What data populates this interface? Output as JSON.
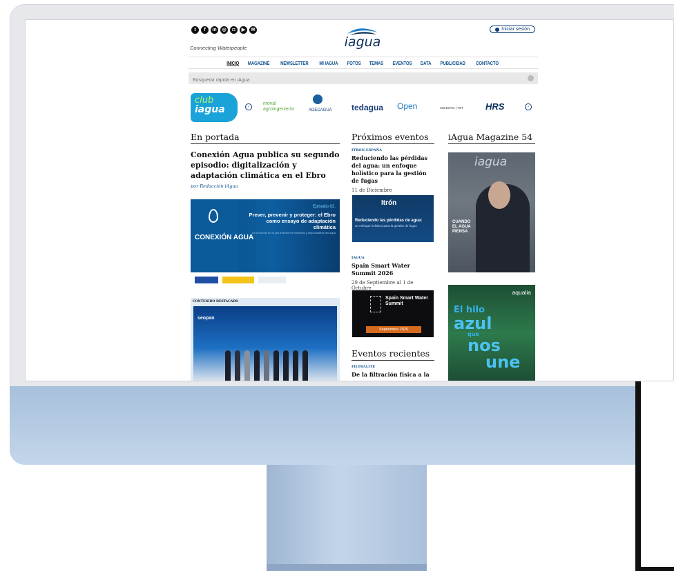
{
  "site": {
    "socials": [
      "Twitter",
      "Facebook",
      "LinkedIn",
      "Instagram",
      "Flickr",
      "YouTube",
      "Email"
    ],
    "social_glyphs": [
      "t",
      "f",
      "in",
      "◎",
      "◘",
      "▶",
      "✉"
    ],
    "tagline": "Connecting Waterpeople",
    "logo_text": "iagua",
    "login_label": "Iniciar sesión",
    "nav": [
      "INICIO",
      "MAGAZINE",
      "NEWSLETTER",
      "MI IAGUA",
      "FOTOS",
      "TEMAS",
      "EVENTOS",
      "DATA",
      "PUBLICIDAD",
      "CONTACTO"
    ],
    "search_placeholder": "Búsqueda rápida en iAgua",
    "club_line1": "club",
    "club_line2": "iagua",
    "sponsors": [
      "moval agroingeniería",
      "ADECAGUA",
      "tedagua",
      "Open",
      "CELESTIA | TST",
      "HRS"
    ],
    "prev_arrow": "‹",
    "next_arrow": "›",
    "accent": "#0b4e8c"
  },
  "portada": {
    "title": "En portada",
    "headline": "Conexión Agua publica su segundo episodio: digitalización y adaptación climática en el Ebro",
    "byline": "por Redacción iAgua",
    "banner": {
      "episode": "Episodio 02.",
      "headline": "Prever, prevenir y proteger: el Ebro como ensayo de adaptación climática",
      "subtext": "Un recorrido en el que intervienen expertos y responsables del agua",
      "brand": "CONEXIÓN AGUA"
    },
    "featured_label": "CONTENIDO DESTACADO",
    "featured_logo": "seopan"
  },
  "eventos": {
    "title": "Próximos eventos",
    "items": [
      {
        "kicker": "ITRON ESPAÑA",
        "title": "Reduciendo las pérdidas del agua: un enfoque holístico para la gestión de fugas",
        "date": "11 de Diciembre",
        "img_title": "Reduciendo las pérdidas de agua:",
        "img_sub": "un enfoque holístico para la gestión de fugas",
        "img_brand": "Itrón"
      },
      {
        "kicker": "IAGUA",
        "title": "Spain Smart Water Summit 2026",
        "date": "29 de Septiembre al 1 de Octubre",
        "img_title": "Spain Smart Water Summit",
        "img_sub": "Septiembre 2026"
      }
    ],
    "recent_title": "Eventos recientes",
    "recent": [
      {
        "kicker": "FILTRALITE",
        "title": "De la filtración física a la"
      }
    ]
  },
  "magazine": {
    "title": "iAgua Magazine 54",
    "cover_logo": "iagua",
    "cover_text": "CUANDO EL AGUA PIENSA",
    "ad_brand": "aqualia",
    "ad_lines": [
      "El hilo",
      "azul",
      "que",
      "nos",
      "une"
    ]
  }
}
